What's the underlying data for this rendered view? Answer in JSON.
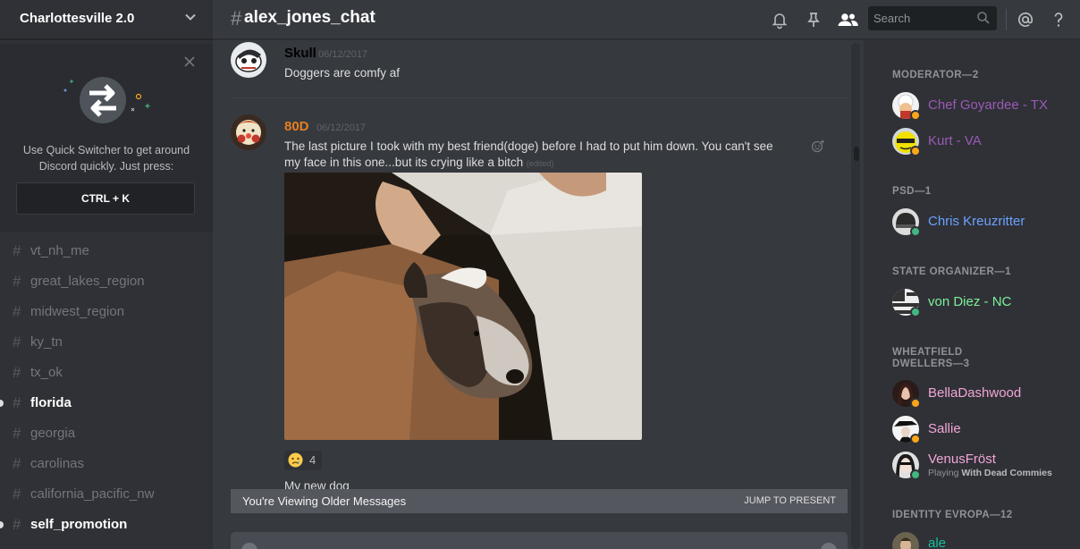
{
  "server": {
    "name": "Charlottesville 2.0"
  },
  "quick_switcher": {
    "text_line1": "Use Quick Switcher to get around",
    "text_line2": "Discord quickly. Just press:",
    "shortcut": "CTRL + K"
  },
  "channels": [
    {
      "name": "vt_nh_me",
      "unread": false
    },
    {
      "name": "great_lakes_region",
      "unread": false
    },
    {
      "name": "midwest_region",
      "unread": false
    },
    {
      "name": "ky_tn",
      "unread": false
    },
    {
      "name": "tx_ok",
      "unread": false
    },
    {
      "name": "florida",
      "unread": true
    },
    {
      "name": "georgia",
      "unread": false
    },
    {
      "name": "carolinas",
      "unread": false
    },
    {
      "name": "california_pacific_nw",
      "unread": false
    },
    {
      "name": "self_promotion",
      "unread": true
    }
  ],
  "chat": {
    "hash": "#",
    "channel_name": "alex_jones_chat",
    "search_placeholder": "Search"
  },
  "messages": [
    {
      "author": "Skull",
      "timestamp": "06/12/2017",
      "author_color": "#ffffff",
      "lines": [
        "Doggers are comfy af"
      ]
    },
    {
      "author": "80D",
      "timestamp": "06/12/2017",
      "author_color": "#e67e22",
      "lines": [
        "The last picture I took with my best friend(doge) before I had to put him down. You can't see",
        "my face in this one...but its crying like a bitch"
      ],
      "edited": "(edited)",
      "reaction": {
        "emoji": "crying-face",
        "count": "4"
      },
      "next_line": "My new dog"
    }
  ],
  "older_messages_bar": {
    "label": "You're Viewing Older Messages",
    "action": "JUMP TO PRESENT"
  },
  "member_list": {
    "groups": [
      {
        "title": "MODERATOR—2",
        "members": [
          {
            "name": "Chef Goyardee - TX",
            "color": "#9b59b6",
            "status": "idle"
          },
          {
            "name": "Kurt - VA",
            "color": "#9b59b6",
            "status": "idle"
          }
        ]
      },
      {
        "title": "PSD—1",
        "members": [
          {
            "name": "Chris Kreuzritter",
            "color": "#6ba1ff",
            "status": "online"
          }
        ]
      },
      {
        "title": "STATE ORGANIZER—1",
        "members": [
          {
            "name": "von Diez - NC",
            "color": "#7ff09a",
            "status": "online"
          }
        ]
      },
      {
        "title_line1": "WHEATFIELD",
        "title_line2": "DWELLERS—3",
        "members": [
          {
            "name": "BellaDashwood",
            "color": "#f3a5d6",
            "status": "idle"
          },
          {
            "name": "Sallie",
            "color": "#f3a5d6",
            "status": "idle"
          },
          {
            "name": "VenusFröst",
            "color": "#f3a5d6",
            "status": "online",
            "activity_prefix": "Playing ",
            "activity": "With Dead Commies"
          }
        ]
      },
      {
        "title": "IDENTITY EVROPA—12",
        "members": [
          {
            "name": "ale",
            "color": "#1abc9c",
            "status": "online"
          }
        ]
      }
    ]
  },
  "colors": {
    "accent": "#7289da",
    "online": "#43b581",
    "idle": "#faa61a"
  }
}
